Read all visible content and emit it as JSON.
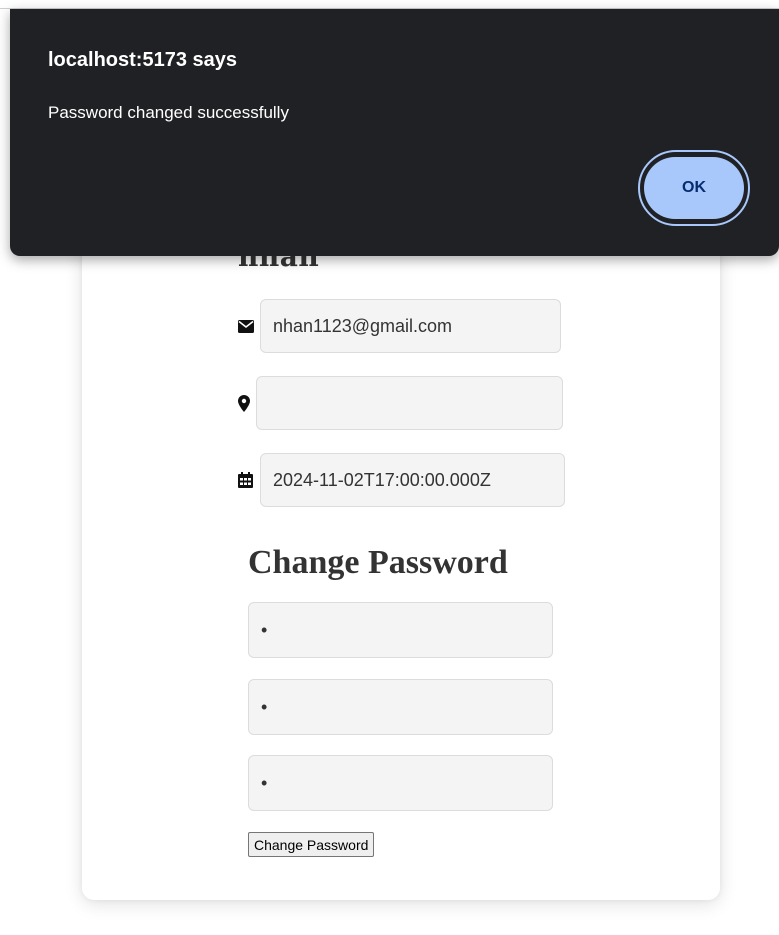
{
  "profile": {
    "username": "nhan",
    "email": "nhan1123@gmail.com",
    "address": "",
    "birthdate": "2024-11-02T17:00:00.000Z"
  },
  "change_password": {
    "title": "Change Password",
    "field_values": [
      "•",
      "•",
      "•"
    ],
    "button_label": "Change Password"
  },
  "dialog": {
    "title": "localhost:5173 says",
    "message": "Password changed successfully",
    "ok_label": "OK"
  },
  "icons": {
    "email": "envelope-icon",
    "address": "map-marker-icon",
    "birthdate": "calendar-icon"
  },
  "colors": {
    "dialog_bg": "#202124",
    "ok_button_bg": "#a8c7fa",
    "ok_button_text": "#062e6f",
    "input_bg": "#f4f4f4"
  }
}
